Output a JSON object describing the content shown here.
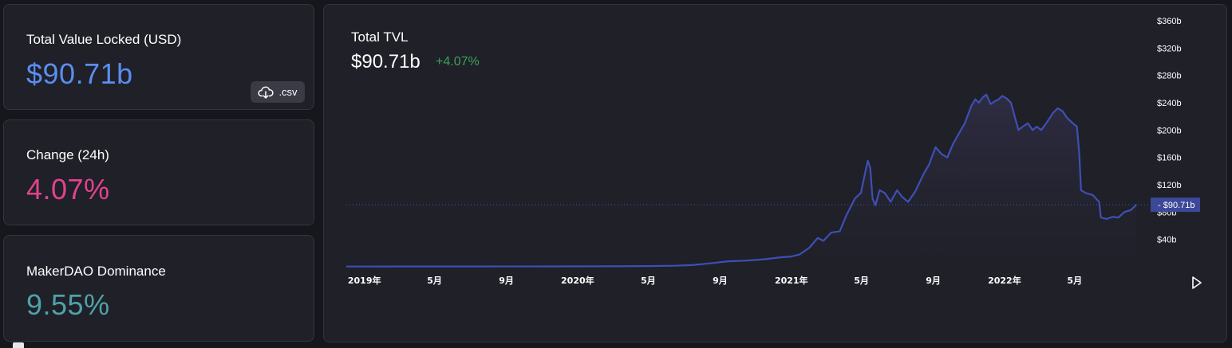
{
  "cards": {
    "tvl": {
      "label": "Total Value Locked (USD)",
      "value": "$90.71b",
      "color": "#5b8def"
    },
    "change": {
      "label": "Change (24h)",
      "value": "4.07%",
      "color": "#e2428d"
    },
    "dominance": {
      "label": "MakerDAO Dominance",
      "value": "9.55%",
      "color": "#4fa3a8"
    }
  },
  "csv_button": {
    "label": ".csv",
    "icon": "cloud-download-icon"
  },
  "chart": {
    "title": "Total TVL",
    "value": "$90.71b",
    "change": "+4.07%",
    "current_tag": "$90.71b"
  },
  "play_icon": "play-icon",
  "colors": {
    "line": "#3e4fb5",
    "area_top": "#2e2c42",
    "change_green": "#3fa05a",
    "bg": "#1f2028"
  },
  "chart_data": {
    "type": "area",
    "title": "Total TVL",
    "xlabel": "",
    "ylabel": "",
    "ylim": [
      0,
      360
    ],
    "y_ticks": [
      "$40b",
      "$80b",
      "$120b",
      "$160b",
      "$200b",
      "$240b",
      "$280b",
      "$320b",
      "$360b"
    ],
    "y_tick_values": [
      40,
      80,
      120,
      160,
      200,
      240,
      280,
      320,
      360
    ],
    "x_ticks": [
      "2019年",
      "5月",
      "9月",
      "2020年",
      "5月",
      "9月",
      "2021年",
      "5月",
      "9月",
      "2022年",
      "5月"
    ],
    "x_tick_dates": [
      "2019-01",
      "2019-05",
      "2019-09",
      "2020-01",
      "2020-05",
      "2020-09",
      "2021-01",
      "2021-05",
      "2021-09",
      "2022-01",
      "2022-05"
    ],
    "x_range": [
      "2018-12",
      "2022-08-20"
    ],
    "current_value": 90.71,
    "series": [
      {
        "unit": "$b",
        "points": [
          [
            "2018-12-01",
            0.3
          ],
          [
            "2019-03-01",
            0.5
          ],
          [
            "2019-07-01",
            0.5
          ],
          [
            "2019-12-01",
            0.6
          ],
          [
            "2020-03-01",
            0.7
          ],
          [
            "2020-05-01",
            1.0
          ],
          [
            "2020-06-15",
            1.5
          ],
          [
            "2020-07-15",
            2.5
          ],
          [
            "2020-08-15",
            5
          ],
          [
            "2020-09-15",
            8
          ],
          [
            "2020-10-15",
            9
          ],
          [
            "2020-11-15",
            11
          ],
          [
            "2020-12-15",
            14
          ],
          [
            "2021-01-01",
            15
          ],
          [
            "2021-01-15",
            18
          ],
          [
            "2021-02-01",
            28
          ],
          [
            "2021-02-15",
            42
          ],
          [
            "2021-02-25",
            38
          ],
          [
            "2021-03-10",
            50
          ],
          [
            "2021-03-25",
            52
          ],
          [
            "2021-04-05",
            75
          ],
          [
            "2021-04-20",
            100
          ],
          [
            "2021-04-30",
            108
          ],
          [
            "2021-05-08",
            140
          ],
          [
            "2021-05-12",
            155
          ],
          [
            "2021-05-16",
            145
          ],
          [
            "2021-05-20",
            100
          ],
          [
            "2021-05-25",
            90
          ],
          [
            "2021-06-01",
            112
          ],
          [
            "2021-06-10",
            108
          ],
          [
            "2021-06-20",
            95
          ],
          [
            "2021-07-01",
            112
          ],
          [
            "2021-07-10",
            102
          ],
          [
            "2021-07-20",
            95
          ],
          [
            "2021-08-01",
            110
          ],
          [
            "2021-08-15",
            135
          ],
          [
            "2021-08-25",
            150
          ],
          [
            "2021-09-05",
            175
          ],
          [
            "2021-09-15",
            165
          ],
          [
            "2021-09-25",
            160
          ],
          [
            "2021-10-05",
            180
          ],
          [
            "2021-10-15",
            195
          ],
          [
            "2021-10-25",
            210
          ],
          [
            "2021-11-05",
            235
          ],
          [
            "2021-11-12",
            245
          ],
          [
            "2021-11-18",
            240
          ],
          [
            "2021-11-25",
            248
          ],
          [
            "2021-12-01",
            252
          ],
          [
            "2021-12-08",
            238
          ],
          [
            "2021-12-15",
            242
          ],
          [
            "2021-12-22",
            245
          ],
          [
            "2021-12-28",
            250
          ],
          [
            "2022-01-05",
            246
          ],
          [
            "2022-01-12",
            240
          ],
          [
            "2022-01-20",
            215
          ],
          [
            "2022-01-25",
            200
          ],
          [
            "2022-02-01",
            205
          ],
          [
            "2022-02-10",
            210
          ],
          [
            "2022-02-18",
            200
          ],
          [
            "2022-02-25",
            205
          ],
          [
            "2022-03-05",
            200
          ],
          [
            "2022-03-15",
            212
          ],
          [
            "2022-03-25",
            225
          ],
          [
            "2022-04-02",
            232
          ],
          [
            "2022-04-10",
            228
          ],
          [
            "2022-04-18",
            218
          ],
          [
            "2022-04-28",
            210
          ],
          [
            "2022-05-05",
            205
          ],
          [
            "2022-05-09",
            165
          ],
          [
            "2022-05-12",
            112
          ],
          [
            "2022-05-20",
            108
          ],
          [
            "2022-06-01",
            105
          ],
          [
            "2022-06-12",
            95
          ],
          [
            "2022-06-15",
            72
          ],
          [
            "2022-06-25",
            70
          ],
          [
            "2022-07-05",
            73
          ],
          [
            "2022-07-15",
            72
          ],
          [
            "2022-07-25",
            80
          ],
          [
            "2022-08-05",
            83
          ],
          [
            "2022-08-15",
            90.71
          ]
        ]
      }
    ]
  }
}
